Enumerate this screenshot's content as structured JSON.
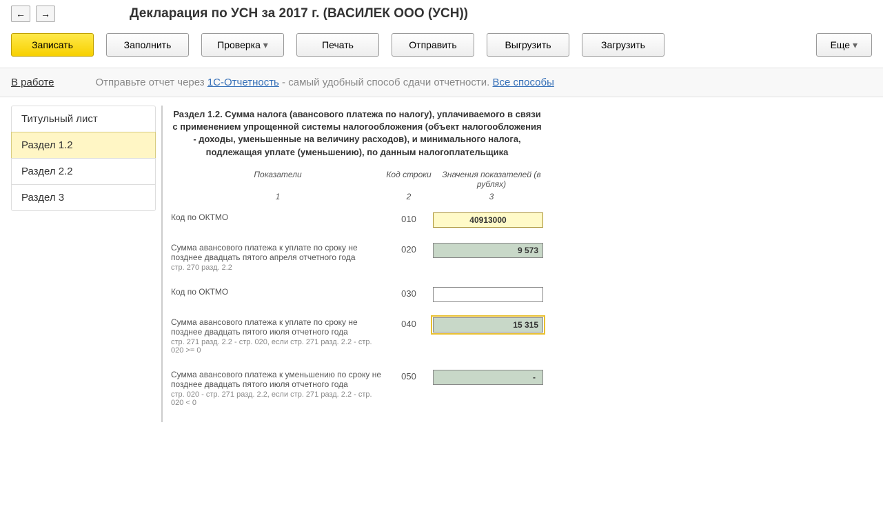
{
  "header": {
    "title": "Декларация по УСН за 2017 г. (ВАСИЛЕК ООО (УСН))"
  },
  "toolbar": {
    "save": "Записать",
    "fill": "Заполнить",
    "check": "Проверка",
    "print": "Печать",
    "send": "Отправить",
    "export": "Выгрузить",
    "import": "Загрузить",
    "more": "Еще"
  },
  "info": {
    "status": "В работе",
    "text_before": "Отправьте отчет через ",
    "link1": "1С-Отчетность",
    "text_after": " - самый удобный способ сдачи отчетности. ",
    "link2": "Все способы"
  },
  "sidebar": {
    "items": [
      {
        "label": "Титульный лист"
      },
      {
        "label": "Раздел 1.2"
      },
      {
        "label": "Раздел 2.2"
      },
      {
        "label": "Раздел 3"
      }
    ]
  },
  "section": {
    "title": "Раздел 1.2. Сумма налога (авансового платежа по налогу), уплачиваемого в связи с применением упрощенной системы налогообложения (объект налогообложения - доходы, уменьшенные на величину расходов), и минимального налога, подлежащая уплате (уменьшению), по данным налогоплательщика",
    "col_headers": {
      "c1": "Показатели",
      "c2": "Код строки",
      "c3": "Значения показателей (в рублях)"
    },
    "col_nums": {
      "c1": "1",
      "c2": "2",
      "c3": "3"
    }
  },
  "rows": [
    {
      "label": "Код по ОКТМО",
      "sub": "",
      "code": "010",
      "value": "40913000",
      "style": "yellow"
    },
    {
      "label": "Сумма авансового платежа к уплате по сроку не позднее двадцать пятого апреля отчетного года",
      "sub": "стр. 270 разд. 2.2",
      "code": "020",
      "value": "9 573",
      "style": "green"
    },
    {
      "label": "Код по ОКТМО",
      "sub": "",
      "code": "030",
      "value": "",
      "style": "white"
    },
    {
      "label": "Сумма  авансового платежа к уплате по сроку не позднее двадцать пятого июля отчетного года",
      "sub": "стр. 271 разд. 2.2 - стр. 020, если стр. 271 разд. 2.2 - стр. 020 >= 0",
      "code": "040",
      "value": "15 315",
      "style": "green-sel"
    },
    {
      "label": "Сумма авансового платежа к уменьшению по сроку не позднее двадцать пятого июля отчетного года",
      "sub": "стр. 020 - стр. 271 разд. 2.2, если стр. 271 разд. 2.2 - стр. 020 < 0",
      "code": "050",
      "value": "-",
      "style": "green-dash"
    }
  ]
}
